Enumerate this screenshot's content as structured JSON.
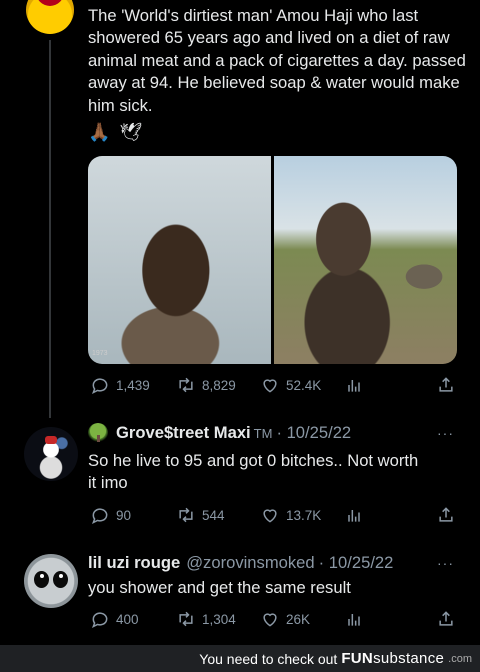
{
  "main_tweet": {
    "text": "The 'World's dirtiest man' Amou Haji who last showered 65 years ago and lived on a diet of raw animal meat and a pack of cigarettes a day. passed away at 94. He believed soap & water would make him sick.",
    "emojis": [
      "🙏🏾",
      "🕊"
    ],
    "media_caption": "1973",
    "stats": {
      "replies": "1,439",
      "retweets": "8,829",
      "likes": "52.4K"
    }
  },
  "replies": [
    {
      "name": "Grove$treet Maxi",
      "badge": "TM",
      "date": "· 10/25/22",
      "text": "So he live to 95 and got 0 bitches.. Not worth it imo",
      "stats": {
        "replies": "90",
        "retweets": "544",
        "likes": "13.7K"
      }
    },
    {
      "name": "lil uzi rouge",
      "handle": "@zorovinsmoked",
      "date": "· 10/25/22",
      "text": "you shower and get the same result",
      "stats": {
        "replies": "400",
        "retweets": "1,304",
        "likes": "26K"
      }
    }
  ],
  "more_label": "···",
  "footer": {
    "text": "You need to check out",
    "brand_bold": "FUN",
    "brand_light": "substance",
    "domain": ".com"
  }
}
